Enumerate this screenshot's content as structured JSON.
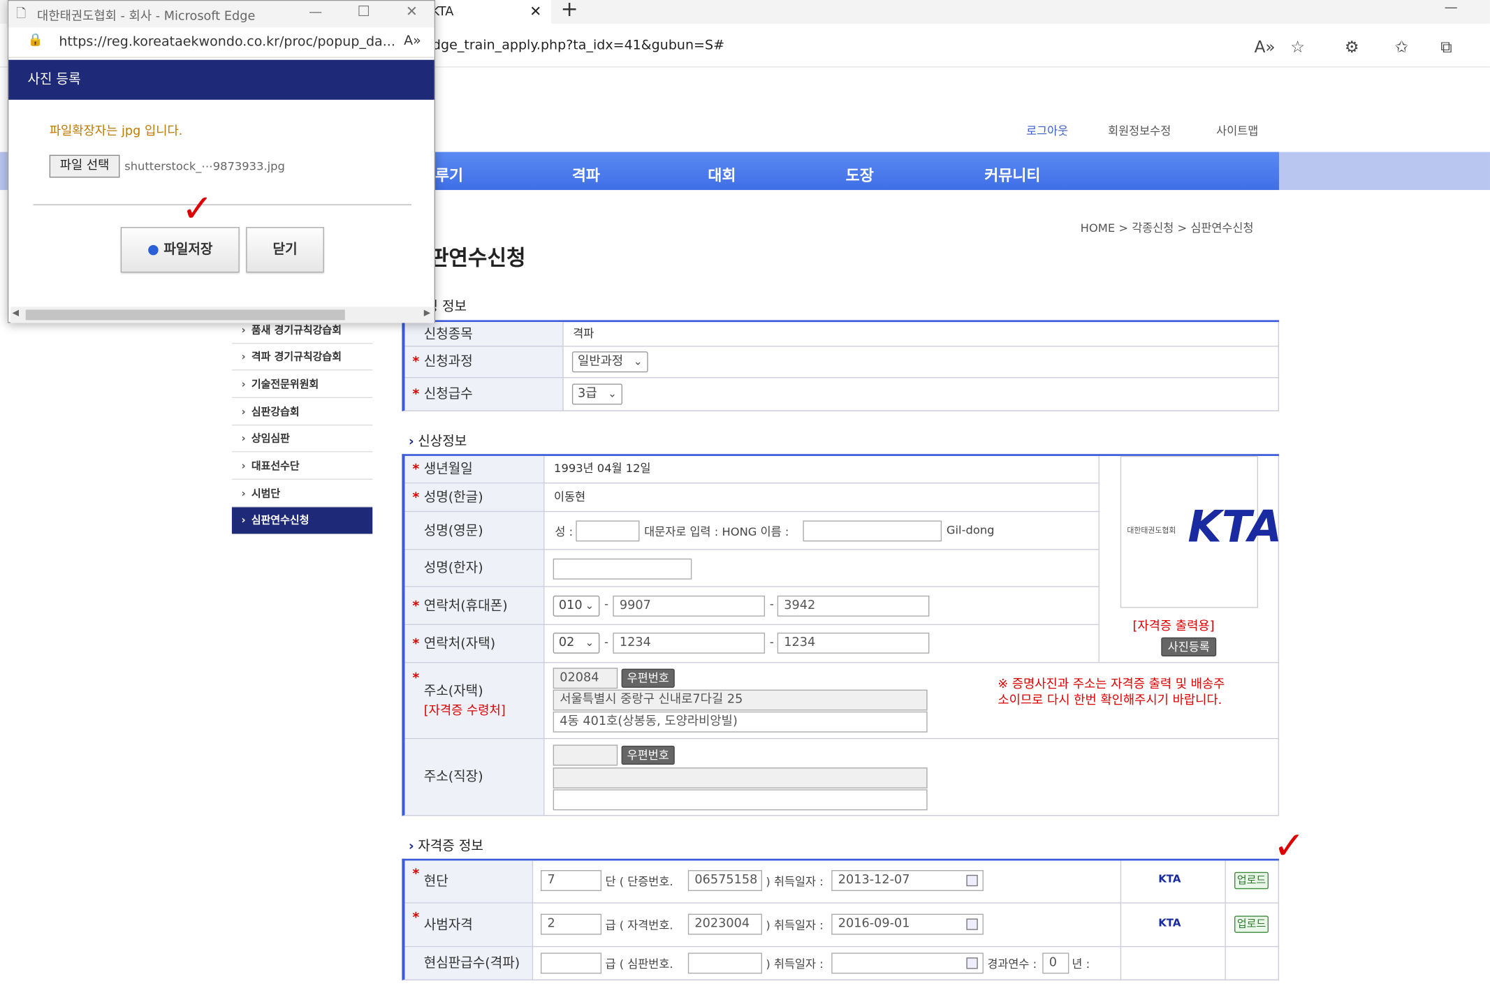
{
  "browser": {
    "tab_title": "KTA",
    "url_suffix": "dge_train_apply.php?ta_idx=41&gubun=S#"
  },
  "util_links": [
    "로그아웃",
    "회원정보수정",
    "사이트맵"
  ],
  "nav": [
    "루기",
    "격파",
    "대회",
    "도장",
    "커뮤니티"
  ],
  "breadcrumb": "HOME > 각종신청 > 심판연수신청",
  "page_title": "판연수신청",
  "sidebar": [
    "품새 경기규칙강습회",
    "격파 경기규칙강습회",
    "기술전문위원회",
    "심판강습회",
    "상임심판",
    "대표선수단",
    "시범단",
    "심판연수신청"
  ],
  "sections": {
    "apply": "청 정보",
    "personal": "신상정보",
    "cert": "자격증 정보"
  },
  "apply": {
    "event_label": "신청종목",
    "event_value": "격파",
    "course_label": "신청과정",
    "course_value": "일반과정",
    "grade_label": "신청급수",
    "grade_value": "3급"
  },
  "personal": {
    "birth_label": "생년월일",
    "birth_value": "1993년 04월 12일",
    "name_kr_label": "성명(한글)",
    "name_kr_value": "이동현",
    "name_en_label": "성명(영문)",
    "surname": "성 :",
    "upper_hint": "대문자로 입력 : HONG 이름 :",
    "given_hint": "Gil-dong",
    "name_cn_label": "성명(한자)",
    "mobile_label": "연락처(휴대폰)",
    "mobile": [
      "010",
      "9907",
      "3942"
    ],
    "home_label": "연락처(자택)",
    "home": [
      "02",
      "1234",
      "1234"
    ],
    "addr_home_label": "주소(자택)",
    "addr_home_sub": "[자격증 수령처]",
    "zip": "02084",
    "zip_btn": "우편번호",
    "addr1": "서울특별시 중랑구 신내로7다길 25",
    "addr2": "4동 401호(상봉동, 도양라비앙빌)",
    "notice": "※ 증명사진과 주소는 자격증 출력 및 배송주소이므로 다시 한번 확인해주시기 바랍니다.",
    "addr_work_label": "주소(직장)",
    "photo_caption": "[자격증 출력용]",
    "photo_btn": "사진등록",
    "photo_logo": "KTA",
    "dash": "-"
  },
  "cert": {
    "dan_label": "현단",
    "dan_value": "7",
    "dan_unit": "단 ( 단증번호.",
    "dan_no": "06575158",
    "acq": ") 취득일자 :",
    "dan_date": "2013-12-07",
    "master_label": "사범자격",
    "master_value": "2",
    "grade_unit": "급 ( 자격번호.",
    "master_no": "2023004",
    "master_date": "2016-09-01",
    "judge_label": "현심판급수(격파)",
    "judge_unit": "급 ( 심판번호.",
    "years_label": "경과연수 :",
    "years_value": "0",
    "years_unit": "년 :",
    "upload": "업로드",
    "logo": "KTA"
  },
  "popup": {
    "window_title": "대한태권도협회 - 회사 - Microsoft Edge",
    "url": "https://reg.koreataekwondo.co.kr/proc/popup_da...",
    "header": "사진 등록",
    "notice": "파일확장자는 jpg 입니다.",
    "choose_btn": "파일 선택",
    "file_name": "shutterstock_⋯9873933.jpg",
    "save_btn": "파일저장",
    "close_btn": "닫기"
  }
}
